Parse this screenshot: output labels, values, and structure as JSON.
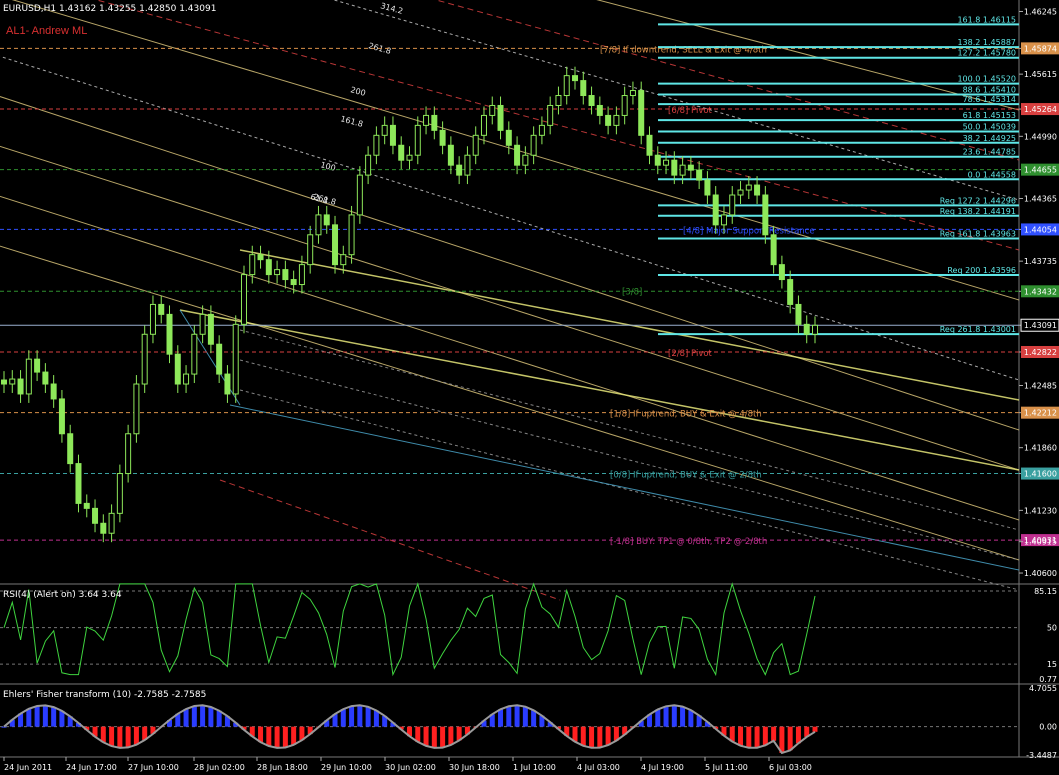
{
  "header": {
    "symbol_info": "EURUSD,H1  1.43162 1.43255 1.42850 1.43091",
    "indicator_label": "AL1- Andrew ML"
  },
  "colors": {
    "background": "#000000",
    "candle": "#8ee85a",
    "fib_line": "#5fe6e6",
    "ml_line": "#d8c27a",
    "rsi_line": "#3fd43f",
    "fisher_up": "#2a3cff",
    "fisher_down": "#ff2020",
    "fisher_line": "#9a9a9a"
  },
  "main_axis": {
    "ticks": [
      "1.46245",
      "1.45874",
      "1.45615",
      "1.45264",
      "1.44990",
      "1.44655",
      "1.44365",
      "1.44054",
      "1.43735",
      "1.43432",
      "1.43091",
      "1.42822",
      "1.42485",
      "1.42212",
      "1.41860",
      "1.41600",
      "1.41230",
      "1.40931",
      "1.40915",
      "1.40600"
    ]
  },
  "time_axis": {
    "labels": [
      "24 Jun 2011",
      "24 Jun 17:00",
      "27 Jun 10:00",
      "28 Jun 02:00",
      "28 Jun 18:00",
      "29 Jun 10:00",
      "30 Jun 02:00",
      "30 Jun 18:00",
      "1 Jul 10:00",
      "4 Jul 03:00",
      "4 Jul 19:00",
      "5 Jul 11:00",
      "6 Jul 03:00"
    ]
  },
  "pitchfork_labels": [
    "314.2",
    "261.8",
    "261.8",
    "200",
    "161.8",
    "100",
    "61.8"
  ],
  "fib_levels": [
    {
      "label": "161.8  1.46115"
    },
    {
      "label": "138.2  1.45887"
    },
    {
      "label": "127.2  1.45780"
    },
    {
      "label": "100.0  1.45520"
    },
    {
      "label": "88.6  1.45410"
    },
    {
      "label": "78.6  1.45314"
    },
    {
      "label": "61.8  1.45153"
    },
    {
      "label": "50.0  1.45039"
    },
    {
      "label": "38.2  1.44925"
    },
    {
      "label": "23.6  1.44785"
    },
    {
      "label": "0.0  1.44558"
    },
    {
      "label": "Req 127.2  1.44296"
    },
    {
      "label": "Req 138.2  1.44191"
    },
    {
      "label": "Req 161.8  1.43963"
    },
    {
      "label": "Req 200  1.43596"
    },
    {
      "label": "Req 261.8  1.43001"
    }
  ],
  "murrey_labels": [
    {
      "text": "[7/8] If downtrend, SELL & Exit @ 4/8th",
      "color": "#d9914a"
    },
    {
      "text": "[6/8] Pivot",
      "color": "#d84040"
    },
    {
      "text": "[4/8] Major Support/Resistance",
      "color": "#3050ff"
    },
    {
      "text": "[3/8]",
      "color": "#2f8f2f"
    },
    {
      "text": "[2/8] Pivot",
      "color": "#d84040"
    },
    {
      "text": "[1/8] If uptrend, BUY & Exit @ 4/8th",
      "color": "#d9914a"
    },
    {
      "text": "[0/8] If uptrend, BUY & Exit @ 2/8th",
      "color": "#3aa0a0"
    },
    {
      "text": "[-1/8] BUY: TP1 @ 0/8th, TP2 @ 2/8th",
      "color": "#c03090"
    }
  ],
  "rsi": {
    "label": "RSI(4) (Alert on) 3.64 3.64",
    "ticks": [
      "85.15",
      "50",
      "15",
      "0.77"
    ]
  },
  "fisher": {
    "label": "Ehlers' Fisher transform (10) -2.7585 -2.7585",
    "ticks": [
      "4.7055",
      "0.00",
      "-3.4487"
    ]
  },
  "chart_data": {
    "type": "candlestick",
    "title": "EURUSD,H1",
    "ylim": [
      1.4055,
      1.463
    ],
    "last_price": 1.43091,
    "fib_levels": [
      1.46115,
      1.45887,
      1.4578,
      1.4552,
      1.4541,
      1.45314,
      1.45153,
      1.45039,
      1.44925,
      1.44785,
      1.44558,
      1.44296,
      1.44191,
      1.43963,
      1.43596,
      1.43001
    ],
    "murrey_levels": [
      1.45874,
      1.45264,
      1.44655,
      1.44054,
      1.43432,
      1.42822,
      1.42212,
      1.416,
      1.40931
    ],
    "close_series": [
      1.425,
      1.4255,
      1.424,
      1.4275,
      1.4262,
      1.425,
      1.4235,
      1.42,
      1.417,
      1.413,
      1.4125,
      1.411,
      1.41,
      1.412,
      1.416,
      1.42,
      1.425,
      1.43,
      1.433,
      1.432,
      1.428,
      1.425,
      1.426,
      1.43,
      1.432,
      1.429,
      1.426,
      1.424,
      1.431,
      1.436,
      1.438,
      1.4375,
      1.436,
      1.4365,
      1.4355,
      1.435,
      1.437,
      1.44,
      1.442,
      1.441,
      1.437,
      1.438,
      1.442,
      1.446,
      1.448,
      1.45,
      1.451,
      1.449,
      1.4475,
      1.448,
      1.451,
      1.452,
      1.4505,
      1.449,
      1.447,
      1.446,
      1.448,
      1.45,
      1.452,
      1.453,
      1.4505,
      1.449,
      1.447,
      1.448,
      1.45,
      1.451,
      1.453,
      1.454,
      1.456,
      1.4555,
      1.454,
      1.453,
      1.452,
      1.451,
      1.452,
      1.454,
      1.4545,
      1.45,
      1.448,
      1.447,
      1.4475,
      1.446,
      1.447,
      1.4465,
      1.4455,
      1.444,
      1.441,
      1.442,
      1.444,
      1.4445,
      1.445,
      1.444,
      1.44,
      1.437,
      1.4355,
      1.433,
      1.431,
      1.43,
      1.4309
    ]
  }
}
